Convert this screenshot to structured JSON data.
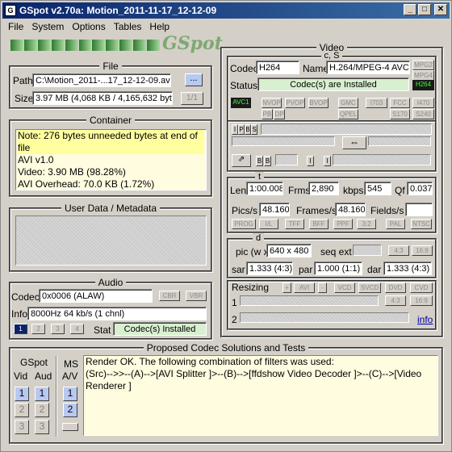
{
  "title": "GSpot v2.70a: Motion_2011-11-17_12-12-09",
  "menu": [
    "File",
    "System",
    "Options",
    "Tables",
    "Help"
  ],
  "logo": "GSpot",
  "file": {
    "label": "File",
    "path_label": "Path",
    "path": "C:\\Motion_2011-...17_12-12-09.avi",
    "browse": "...",
    "size_label": "Size",
    "size": "3.97 MB (4,068 KB / 4,165,632 byte",
    "page": "1/1"
  },
  "container": {
    "label": "Container",
    "lines": [
      "Note: 276 bytes unneeded bytes at end of file",
      "AVI v1.0",
      "Video: 3.90 MB (98.28%)",
      "AVI Overhead: 70.0 KB (1.72%)"
    ]
  },
  "userdata": {
    "label": "User Data / Metadata"
  },
  "audio": {
    "label": "Audio",
    "codec_label": "Codec",
    "codec": "0x0006 (ALAW)",
    "cbr": "CBR",
    "vbr": "VBR",
    "info_label": "Info",
    "info": "8000Hz  64 kb/s (1 chnl)",
    "tracks": [
      "1",
      "2",
      "3",
      "4"
    ],
    "stat_label": "Stat",
    "stat": "Codec(s) Installed"
  },
  "video": {
    "label": "Video",
    "cs_label": "c, S",
    "codec_label": "Codec",
    "codec": "H264",
    "name_label": "Name",
    "name": "H.264/MPEG-4 AVC",
    "mpg2": "MPG2",
    "mpg4": "MPG4",
    "status_label": "Status",
    "status": "Codec(s) are Installed",
    "h264": "H264",
    "flags_row1": [
      "AVC1",
      "NVOP",
      "PVOP",
      "BVOP",
      "GMC",
      "I703",
      "FCC",
      "I470"
    ],
    "flags_row2": [
      "PB",
      "DP",
      "QPEL",
      "S170",
      "S240"
    ],
    "ipbs": [
      "I",
      "P",
      "B",
      "S"
    ],
    "bb": [
      "B",
      "B"
    ],
    "ii": [
      "I",
      "I"
    ],
    "t_label": "t",
    "len_label": "Len",
    "len": "1:00.008",
    "frms_label": "Frms",
    "frms": "2,890",
    "kbps_label": "kbps",
    "kbps": "545",
    "qf_label": "Qf",
    "qf": "0.037",
    "pics_label": "Pics/s",
    "pics": "48.160",
    "frames_label": "Frames/s",
    "frames": "48.160",
    "fields_label": "Fields/s",
    "fields": "",
    "frame_btns": [
      "PROG",
      "I/L",
      "TFF",
      "BFF",
      "PPF",
      "3:2",
      "PAL",
      "NTSC"
    ],
    "d_label": "d",
    "pic_label": "pic (w x",
    "pic": "640 x 480",
    "seqext_label": "seq ext",
    "ar43": "4:3",
    "ar169": "16:9",
    "sar_label": "sar",
    "sar": "1.333 (4:3)",
    "par_label": "par",
    "par": "1.000 (1:1)",
    "dar_label": "dar",
    "dar": "1.333 (4:3)",
    "resizing_label": "Resizing",
    "resize_btns": [
      "+",
      "AVI",
      "-",
      "VCD",
      "SVCD",
      "DVD",
      "CVD"
    ],
    "r1": "1",
    "r2": "2",
    "r43": "4:3",
    "r169": "16:9",
    "info_link": "info"
  },
  "proposed": {
    "label": "Proposed Codec Solutions and Tests",
    "gspot_label": "GSpot",
    "ms_label": "MS",
    "vid": "Vid",
    "aud": "Aud",
    "av": "A/V",
    "nums": [
      "1",
      "2",
      "3"
    ],
    "lines": [
      "Render OK. The following combination of filters was used:",
      "(Src)-->>--(A)-->[AVI Splitter ]>--(B)-->[ffdshow Video Decoder ]>--(C)-->[Video Renderer ]"
    ]
  }
}
